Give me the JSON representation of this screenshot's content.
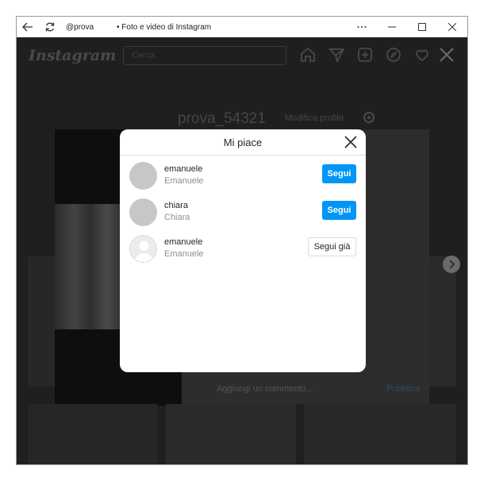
{
  "window": {
    "username": "@prova",
    "title": "• Foto e video di Instagram"
  },
  "instagram": {
    "logo": "Instagram",
    "search_placeholder": "Cerca",
    "profile_name": "prova_54321",
    "edit_profile": "Modifica profilo",
    "comment_placeholder": "Aggiungi un commento...",
    "publish": "Pubblica"
  },
  "modal": {
    "title": "Mi piace",
    "users": [
      {
        "username": "emanuele",
        "fullname": "Emanuele",
        "button": "Segui",
        "following": false
      },
      {
        "username": "chiara",
        "fullname": "Chiara",
        "button": "Segui",
        "following": false
      },
      {
        "username": "emanuele",
        "fullname": "Emanuele",
        "button": "Segui già",
        "following": true
      }
    ]
  },
  "colors": {
    "follow_blue": "#0095f6",
    "overlay": "#1f1f1f"
  }
}
